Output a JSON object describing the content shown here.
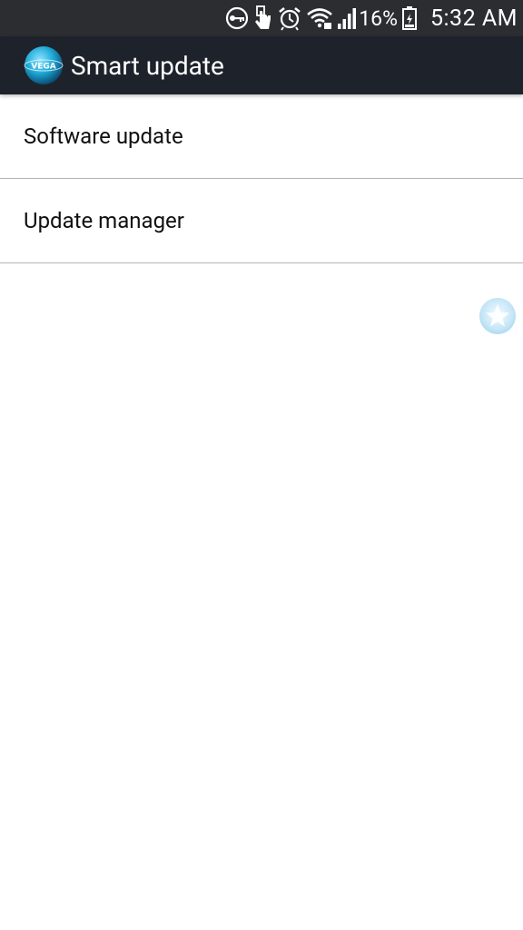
{
  "status_bar": {
    "icons": [
      "vpn-key-icon",
      "touch-icon",
      "alarm-icon",
      "wifi-icon",
      "signal-icon",
      "battery-icon"
    ],
    "battery_percent": "16%",
    "time": "5:32 AM"
  },
  "action_bar": {
    "logo_text": "VEGA",
    "title": "Smart update"
  },
  "menu": {
    "items": [
      {
        "label": "Software update"
      },
      {
        "label": "Update manager"
      }
    ]
  },
  "colors": {
    "status_bar_bg": "#2b2d31",
    "action_bar_bg": "#1e232b",
    "divider": "#b4b4b4",
    "logo_blue": "#1ea9d6"
  }
}
